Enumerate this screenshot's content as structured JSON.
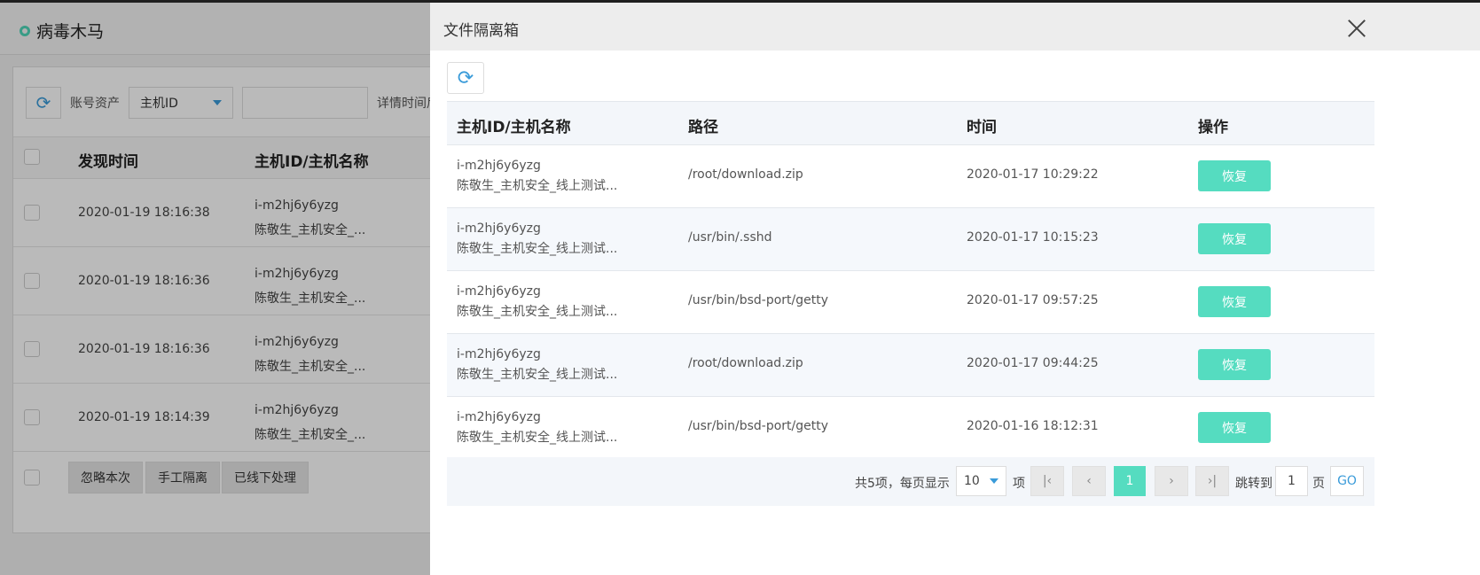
{
  "background": {
    "title": "病毒木马",
    "toolbar": {
      "filter_label": "账号资产",
      "select_value": "主机ID",
      "detail_label": "详情时间后"
    },
    "table": {
      "headers": [
        "发现时间",
        "主机ID/主机名称"
      ],
      "rows": [
        {
          "time": "2020-01-19 18:16:38",
          "host_id": "i-m2hj6y6yzg",
          "host_name": "陈敬生_主机安全_..."
        },
        {
          "time": "2020-01-19 18:16:36",
          "host_id": "i-m2hj6y6yzg",
          "host_name": "陈敬生_主机安全_..."
        },
        {
          "time": "2020-01-19 18:16:36",
          "host_id": "i-m2hj6y6yzg",
          "host_name": "陈敬生_主机安全_..."
        },
        {
          "time": "2020-01-19 18:14:39",
          "host_id": "i-m2hj6y6yzg",
          "host_name": "陈敬生_主机安全_..."
        }
      ]
    },
    "footer_buttons": [
      "忽略本次",
      "手工隔离",
      "已线下处理"
    ]
  },
  "drawer": {
    "title": "文件隔离箱",
    "headers": {
      "host": "主机ID/主机名称",
      "path": "路径",
      "time": "时间",
      "action": "操作"
    },
    "rows": [
      {
        "host_id": "i-m2hj6y6yzg",
        "host_name": "陈敬生_主机安全_线上测试...",
        "path": "/root/download.zip",
        "time": "2020-01-17 10:29:22",
        "action": "恢复"
      },
      {
        "host_id": "i-m2hj6y6yzg",
        "host_name": "陈敬生_主机安全_线上测试...",
        "path": "/usr/bin/.sshd",
        "time": "2020-01-17 10:15:23",
        "action": "恢复"
      },
      {
        "host_id": "i-m2hj6y6yzg",
        "host_name": "陈敬生_主机安全_线上测试...",
        "path": "/usr/bin/bsd-port/getty",
        "time": "2020-01-17 09:57:25",
        "action": "恢复"
      },
      {
        "host_id": "i-m2hj6y6yzg",
        "host_name": "陈敬生_主机安全_线上测试...",
        "path": "/root/download.zip",
        "time": "2020-01-17 09:44:25",
        "action": "恢复"
      },
      {
        "host_id": "i-m2hj6y6yzg",
        "host_name": "陈敬生_主机安全_线上测试...",
        "path": "/usr/bin/bsd-port/getty",
        "time": "2020-01-16 18:12:31",
        "action": "恢复"
      }
    ],
    "pagination": {
      "summary": "共5项，每页显示",
      "page_size": "10",
      "unit": "项",
      "current_page": "1",
      "jump_label": "跳转到",
      "jump_value": "1",
      "page_unit": "页",
      "go_label": "GO"
    }
  },
  "colors": {
    "accent": "#55dcc0",
    "link": "#3a9bd9"
  },
  "icons": {
    "refresh": "refresh-icon",
    "close": "close-icon"
  }
}
